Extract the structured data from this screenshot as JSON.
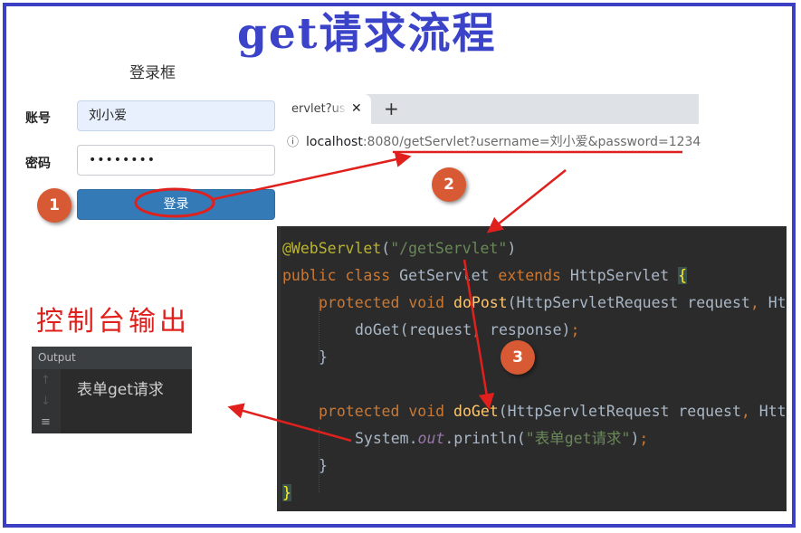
{
  "title": "get请求流程",
  "login_form": {
    "title": "登录框",
    "username_label": "账号",
    "username_value": "刘小爱",
    "password_label": "密码",
    "password_value": "••••••••",
    "submit_label": "登录"
  },
  "browser": {
    "tab_title": "ervlet?user",
    "tab_close": "✕",
    "new_tab": "+",
    "address_icon": "ⓘ",
    "address_host": "localhost",
    "address_path": ":8080/getServlet?username=刘小爱&password=1234"
  },
  "code": {
    "annotation": "@WebServlet",
    "annotation_open": "(",
    "annotation_value": "\"/getServlet\"",
    "annotation_close": ")",
    "class_modifiers": "public class ",
    "class_name": "GetServlet ",
    "extends_kw": "extends ",
    "super_class": "HttpServlet ",
    "open_brace": "{",
    "protected_kw": "protected void ",
    "do_post": "doPost",
    "do_post_params": "(HttpServletRequest request",
    "comma": ",",
    "param_tail": " Htt",
    "do_get_call": "doGet",
    "do_get_call_args": "(request",
    "do_get_call_args2": " response)",
    "semicolon": ";",
    "close_brace": "}",
    "do_get": "doGet",
    "do_get_params": "(HttpServletRequest request",
    "system": "System.",
    "out": "out",
    "println": ".println(",
    "println_arg": "\"表单get请求\"",
    "println_close": ")"
  },
  "console": {
    "heading": "控制台输出",
    "panel_title": "Output",
    "up_arrow": "↑",
    "down_arrow": "↓",
    "menu_icon": "≡",
    "output_line": "表单get请求"
  },
  "steps": [
    "1",
    "2",
    "3"
  ],
  "colors": {
    "frame": "#3a3fc4",
    "title": "#3b43c9",
    "arrow": "#e0201c",
    "step_badge": "#d85a34",
    "login_button": "#337ab7",
    "editor_bg": "#2b2b2b"
  }
}
